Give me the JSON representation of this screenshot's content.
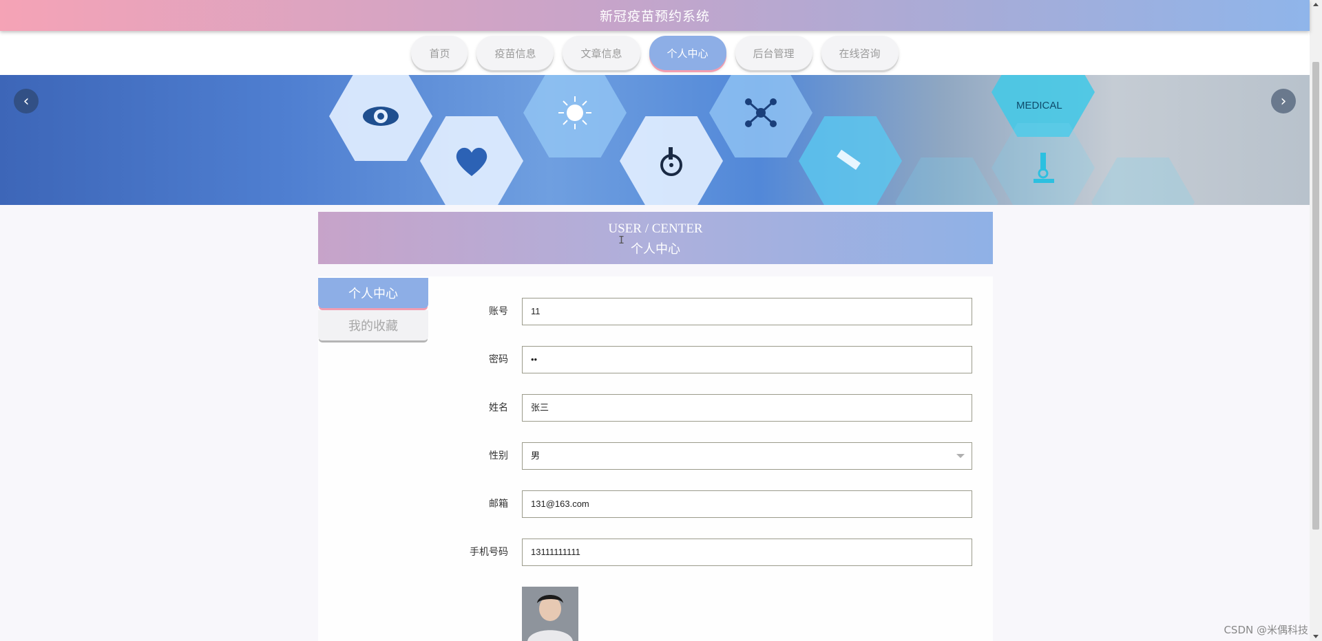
{
  "header": {
    "title": "新冠疫苗预约系统"
  },
  "nav": {
    "items": [
      {
        "label": "首页",
        "active": false
      },
      {
        "label": "疫苗信息",
        "active": false
      },
      {
        "label": "文章信息",
        "active": false
      },
      {
        "label": "个人中心",
        "active": true
      },
      {
        "label": "后台管理",
        "active": false
      },
      {
        "label": "在线咨询",
        "active": false
      }
    ]
  },
  "banner": {
    "medical_label": "MEDICAL"
  },
  "section": {
    "title_en": "USER / CENTER",
    "title_zh": "个人中心"
  },
  "side_menu": {
    "items": [
      "个人中心",
      "我的收藏"
    ],
    "active_index": 0
  },
  "form": {
    "account": {
      "label": "账号",
      "value": "11"
    },
    "password": {
      "label": "密码",
      "value": "••"
    },
    "name": {
      "label": "姓名",
      "value": "张三"
    },
    "gender": {
      "label": "性别",
      "value": "男"
    },
    "email": {
      "label": "邮箱",
      "value": "131@163.com"
    },
    "phone": {
      "label": "手机号码",
      "value": "13111111111"
    }
  },
  "watermark": "CSDN @米偶科技",
  "colors": {
    "accent": "#8daee6",
    "accent_shadow": "#f29db0",
    "header_start": "#f5a3b6",
    "header_end": "#8fb5ea"
  }
}
